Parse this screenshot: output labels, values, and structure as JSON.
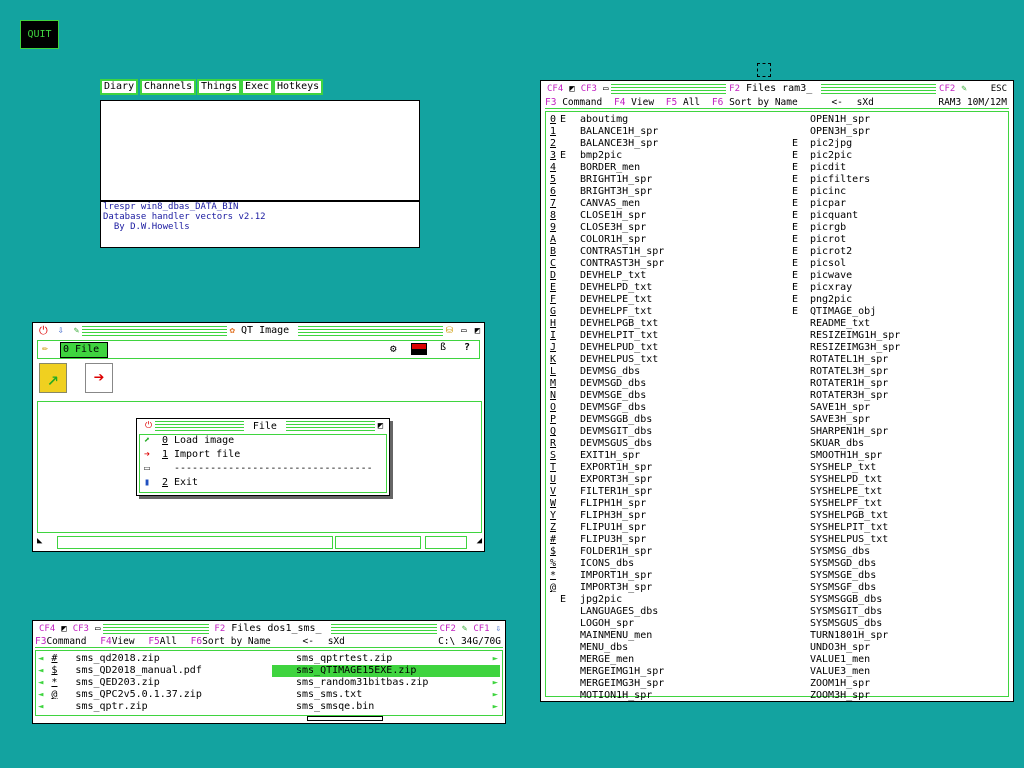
{
  "quit_label": "QUIT",
  "tabs": [
    "Diary",
    "Channels",
    "Things",
    "Exec",
    "Hotkeys"
  ],
  "info": {
    "lines": [
      "lrespr win8_dbas_DATA_BIN",
      "Database handler vectors v2.12",
      "  By D.W.Howells"
    ]
  },
  "qt": {
    "title": "QT Image",
    "menu_label": "0 File",
    "file_menu": {
      "title": "File",
      "items": [
        {
          "key": "0",
          "label": "Load image"
        },
        {
          "key": "1",
          "label": "Import file"
        },
        {
          "key": "",
          "label": "---------------------------------"
        },
        {
          "key": "2",
          "label": "Exit"
        }
      ]
    }
  },
  "files_small": {
    "title": "Files dos1_sms_",
    "cf": [
      "CF4",
      "CF3"
    ],
    "cf_right": [
      "CF2",
      "CF1"
    ],
    "menu": {
      "f3": "F3",
      "command": "Command",
      "f4": "F4",
      "view": "View",
      "f5": "F5",
      "all": "All",
      "f6": "F6",
      "sort": "Sort by Name",
      "back": "<-",
      "sxd": "sXd",
      "drive": "C:\\ 34G/70G"
    },
    "left": [
      {
        "k": "#",
        "n": "sms_qd2018.zip"
      },
      {
        "k": "$",
        "n": "sms_QD2018_manual.pdf"
      },
      {
        "k": "*",
        "n": "sms_QED203.zip"
      },
      {
        "k": "@",
        "n": "sms_QPC2v5.0.1.37.zip"
      },
      {
        "k": "",
        "n": "sms_qptr.zip"
      }
    ],
    "right": [
      {
        "n": "sms_qptrtest.zip"
      },
      {
        "n": "sms_QTIMAGE15EXE.zip",
        "sel": true
      },
      {
        "n": "sms_random31bitbas.zip"
      },
      {
        "n": "sms_sms.txt"
      },
      {
        "n": "sms_smsqe.bin"
      }
    ]
  },
  "files_big": {
    "title": "Files ram3_",
    "cf": [
      "CF4",
      "CF3"
    ],
    "cf_right": "CF2",
    "esc": "ESC",
    "menu": {
      "f3": "F3",
      "command": "Command",
      "f4": "F4",
      "view": "View",
      "f5": "F5",
      "all": "All",
      "f6": "F6",
      "sort": "Sort by Name",
      "back": "<-",
      "sxd": "sXd",
      "drive": "RAM3 10M/12M"
    },
    "left": [
      {
        "k": "0",
        "e": "E",
        "n": "aboutimg"
      },
      {
        "k": "1",
        "e": "",
        "n": "BALANCE1H_spr"
      },
      {
        "k": "2",
        "e": "",
        "n": "BALANCE3H_spr"
      },
      {
        "k": "3",
        "e": "E",
        "n": "bmp2pic"
      },
      {
        "k": "4",
        "e": "",
        "n": "BORDER_men"
      },
      {
        "k": "5",
        "e": "",
        "n": "BRIGHT1H_spr"
      },
      {
        "k": "6",
        "e": "",
        "n": "BRIGHT3H_spr"
      },
      {
        "k": "7",
        "e": "",
        "n": "CANVAS_men"
      },
      {
        "k": "8",
        "e": "",
        "n": "CLOSE1H_spr"
      },
      {
        "k": "9",
        "e": "",
        "n": "CLOSE3H_spr"
      },
      {
        "k": "A",
        "e": "",
        "n": "COLOR1H_spr"
      },
      {
        "k": "B",
        "e": "",
        "n": "CONTRAST1H_spr"
      },
      {
        "k": "C",
        "e": "",
        "n": "CONTRAST3H_spr"
      },
      {
        "k": "D",
        "e": "",
        "n": "DEVHELP_txt"
      },
      {
        "k": "E",
        "e": "",
        "n": "DEVHELPD_txt"
      },
      {
        "k": "F",
        "e": "",
        "n": "DEVHELPE_txt"
      },
      {
        "k": "G",
        "e": "",
        "n": "DEVHELPF_txt"
      },
      {
        "k": "H",
        "e": "",
        "n": "DEVHELPGB_txt"
      },
      {
        "k": "I",
        "e": "",
        "n": "DEVHELPIT_txt"
      },
      {
        "k": "J",
        "e": "",
        "n": "DEVHELPUD_txt"
      },
      {
        "k": "K",
        "e": "",
        "n": "DEVHELPUS_txt"
      },
      {
        "k": "L",
        "e": "",
        "n": "DEVMSG_dbs"
      },
      {
        "k": "M",
        "e": "",
        "n": "DEVMSGD_dbs"
      },
      {
        "k": "N",
        "e": "",
        "n": "DEVMSGE_dbs"
      },
      {
        "k": "O",
        "e": "",
        "n": "DEVMSGF_dbs"
      },
      {
        "k": "P",
        "e": "",
        "n": "DEVMSGGB_dbs"
      },
      {
        "k": "Q",
        "e": "",
        "n": "DEVMSGIT_dbs"
      },
      {
        "k": "R",
        "e": "",
        "n": "DEVMSGUS_dbs"
      },
      {
        "k": "S",
        "e": "",
        "n": "EXIT1H_spr"
      },
      {
        "k": "T",
        "e": "",
        "n": "EXPORT1H_spr"
      },
      {
        "k": "U",
        "e": "",
        "n": "EXPORT3H_spr"
      },
      {
        "k": "V",
        "e": "",
        "n": "FILTER1H_spr"
      },
      {
        "k": "W",
        "e": "",
        "n": "FLIPH1H_spr"
      },
      {
        "k": "Y",
        "e": "",
        "n": "FLIPH3H_spr"
      },
      {
        "k": "Z",
        "e": "",
        "n": "FLIPU1H_spr"
      },
      {
        "k": "#",
        "e": "",
        "n": "FLIPU3H_spr"
      },
      {
        "k": "$",
        "e": "",
        "n": "FOLDER1H_spr"
      },
      {
        "k": "%",
        "e": "",
        "n": "ICONS_dbs"
      },
      {
        "k": "*",
        "e": "",
        "n": "IMPORT1H_spr"
      },
      {
        "k": "@",
        "e": "",
        "n": "IMPORT3H_spr"
      },
      {
        "k": "",
        "e": "E",
        "n": "jpg2pic"
      },
      {
        "k": "",
        "e": "",
        "n": "LANGUAGES_dbs"
      },
      {
        "k": "",
        "e": "",
        "n": "LOGOH_spr"
      },
      {
        "k": "",
        "e": "",
        "n": "MAINMENU_men"
      },
      {
        "k": "",
        "e": "",
        "n": "MENU_dbs"
      },
      {
        "k": "",
        "e": "",
        "n": "MERGE_men"
      },
      {
        "k": "",
        "e": "",
        "n": "MERGEIMG1H_spr"
      },
      {
        "k": "",
        "e": "",
        "n": "MERGEIMG3H_spr"
      },
      {
        "k": "",
        "e": "",
        "n": "MOTION1H_spr"
      }
    ],
    "right": [
      {
        "e": "",
        "n": "OPEN1H_spr"
      },
      {
        "e": "",
        "n": "OPEN3H_spr"
      },
      {
        "e": "E",
        "n": "pic2jpg"
      },
      {
        "e": "E",
        "n": "pic2pic"
      },
      {
        "e": "E",
        "n": "picdit"
      },
      {
        "e": "E",
        "n": "picfilters"
      },
      {
        "e": "E",
        "n": "picinc"
      },
      {
        "e": "E",
        "n": "picpar"
      },
      {
        "e": "E",
        "n": "picquant"
      },
      {
        "e": "E",
        "n": "picrgb"
      },
      {
        "e": "E",
        "n": "picrot"
      },
      {
        "e": "E",
        "n": "picrot2"
      },
      {
        "e": "E",
        "n": "picsol"
      },
      {
        "e": "E",
        "n": "picwave"
      },
      {
        "e": "E",
        "n": "picxray"
      },
      {
        "e": "E",
        "n": "png2pic"
      },
      {
        "e": "E",
        "n": "QTIMAGE_obj"
      },
      {
        "e": "",
        "n": "README_txt"
      },
      {
        "e": "",
        "n": "RESIZEIMG1H_spr"
      },
      {
        "e": "",
        "n": "RESIZEIMG3H_spr"
      },
      {
        "e": "",
        "n": "ROTATEL1H_spr"
      },
      {
        "e": "",
        "n": "ROTATEL3H_spr"
      },
      {
        "e": "",
        "n": "ROTATER1H_spr"
      },
      {
        "e": "",
        "n": "ROTATER3H_spr"
      },
      {
        "e": "",
        "n": "SAVE1H_spr"
      },
      {
        "e": "",
        "n": "SAVE3H_spr"
      },
      {
        "e": "",
        "n": "SHARPEN1H_spr"
      },
      {
        "e": "",
        "n": "SKUAR_dbs"
      },
      {
        "e": "",
        "n": "SMOOTH1H_spr"
      },
      {
        "e": "",
        "n": "SYSHELP_txt"
      },
      {
        "e": "",
        "n": "SYSHELPD_txt"
      },
      {
        "e": "",
        "n": "SYSHELPE_txt"
      },
      {
        "e": "",
        "n": "SYSHELPF_txt"
      },
      {
        "e": "",
        "n": "SYSHELPGB_txt"
      },
      {
        "e": "",
        "n": "SYSHELPIT_txt"
      },
      {
        "e": "",
        "n": "SYSHELPUS_txt"
      },
      {
        "e": "",
        "n": "SYSMSG_dbs"
      },
      {
        "e": "",
        "n": "SYSMSGD_dbs"
      },
      {
        "e": "",
        "n": "SYSMSGE_dbs"
      },
      {
        "e": "",
        "n": "SYSMSGF_dbs"
      },
      {
        "e": "",
        "n": "SYSMSGGB_dbs"
      },
      {
        "e": "",
        "n": "SYSMSGIT_dbs"
      },
      {
        "e": "",
        "n": "SYSMSGUS_dbs"
      },
      {
        "e": "",
        "n": "TURN1801H_spr"
      },
      {
        "e": "",
        "n": "UNDO3H_spr"
      },
      {
        "e": "",
        "n": "VALUE1_men"
      },
      {
        "e": "",
        "n": "VALUE3_men"
      },
      {
        "e": "",
        "n": "ZOOM1H_spr"
      },
      {
        "e": "",
        "n": "ZOOM3H_spr"
      }
    ]
  }
}
